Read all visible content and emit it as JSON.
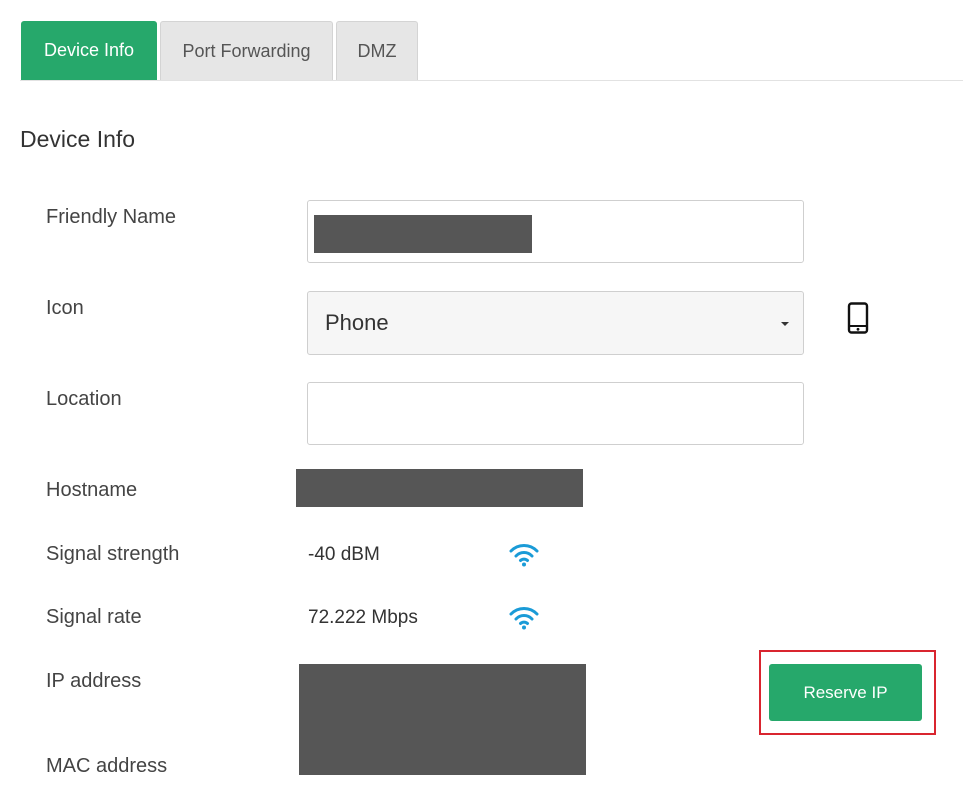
{
  "tabs": [
    {
      "label": "Device Info",
      "active": true
    },
    {
      "label": "Port Forwarding",
      "active": false
    },
    {
      "label": "DMZ",
      "active": false
    }
  ],
  "section_title": "Device Info",
  "fields": {
    "friendly_name": {
      "label": "Friendly Name",
      "value": ""
    },
    "icon": {
      "label": "Icon",
      "selected": "Phone",
      "icon_name": "smartphone-icon"
    },
    "location": {
      "label": "Location",
      "value": ""
    },
    "hostname": {
      "label": "Hostname"
    },
    "signal_strength": {
      "label": "Signal strength",
      "value": "-40 dBM",
      "icon_name": "wifi-icon"
    },
    "signal_rate": {
      "label": "Signal rate",
      "value": "72.222 Mbps",
      "icon_name": "wifi-icon"
    },
    "ip_address": {
      "label": "IP address"
    },
    "mac_address": {
      "label": "MAC address"
    }
  },
  "reserve_ip_button": {
    "label": "Reserve IP"
  },
  "colors": {
    "accent": "#26a86b",
    "wifi": "#1a9bd7",
    "highlight": "#d9252f",
    "redaction": "#565656"
  }
}
